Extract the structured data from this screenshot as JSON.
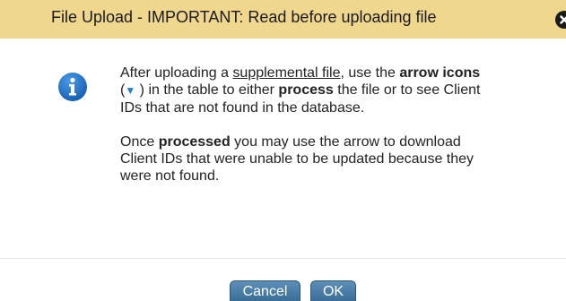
{
  "dialog": {
    "title": "File Upload - IMPORTANT: Read before uploading file",
    "colors": {
      "titlebar": "#f0d78e",
      "info_icon": "#1f6fc5",
      "button": "#4a7ea7"
    },
    "icons": {
      "close": "close-icon",
      "info": "info-icon"
    }
  },
  "message": {
    "p1": {
      "part1": "After uploading a ",
      "link": "supplemental file",
      "part2": ", use the ",
      "bold1": "arrow icons",
      "part3": " (",
      "arrow": "▼",
      "part4": " ) in the table to either ",
      "bold2": "process",
      "part5": " the file or to see Client IDs that are not found in the database."
    },
    "p2": {
      "part1": "Once ",
      "bold": "processed",
      "part2": " you may use the arrow to download Client IDs that were unable to be updated because they were not found."
    }
  },
  "buttons": {
    "cancel": "Cancel",
    "ok": "OK"
  }
}
